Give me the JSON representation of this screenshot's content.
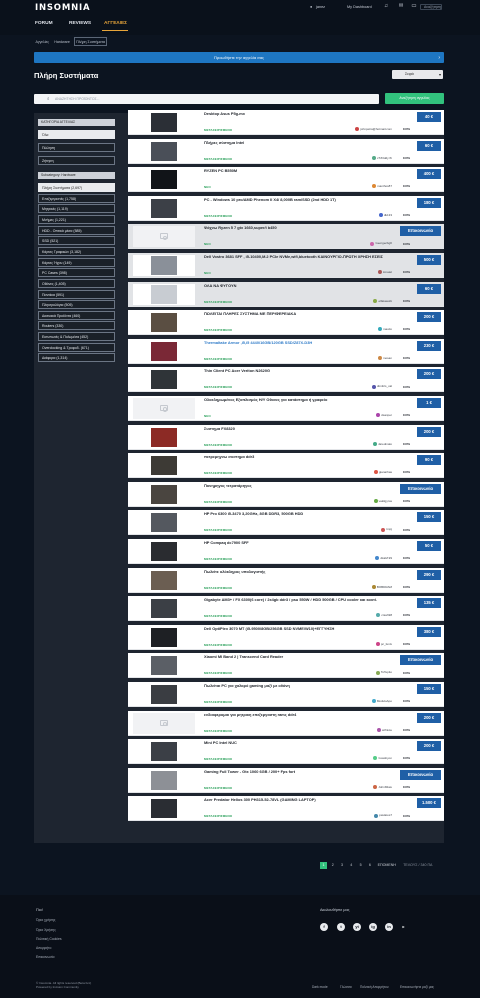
{
  "header": {
    "logo": "INSOMNIA",
    "nav": [
      "FORUM",
      "REVIEWS",
      "ΑΓΓΕΛΙΕΣ"
    ],
    "user": "janez",
    "dashboard": "My Dashboard",
    "search_placeholder": "Αναζήτηση"
  },
  "breadcrumb": [
    "Αγγελίες",
    "Hardware",
    "Πλήρη Συστήματα"
  ],
  "announcement": "Προωθήστε την αγγελία σας",
  "page_title": "Πλήρη Συστήματα",
  "sort_label": "Σειρά",
  "search": {
    "placeholder": "ΑΝΑΖΗΤΗΣΗ ΠΡΟΪΟΝΤΟΣ...",
    "button": "Αναζήτηση αγγελίας"
  },
  "sidebar": {
    "type_header": "ΚΑΤΗΓΟΡΙΑ ΑΓΓΕΛΙΑΣ",
    "types": [
      "Όλα",
      "Πώληση",
      "Ζήτηση"
    ],
    "cat_header": "Subcategory: Hardware",
    "categories": [
      "Πλήρη Συστήματα (2,697)",
      "Επεξεργαστές (1,758)",
      "Μητρικές (1,119)",
      "Μνήμες (1,221)",
      "HDD - Οπτικά μέσα (585)",
      "SSD (521)",
      "Κάρτες Γραφικών (3,182)",
      "Κάρτες Ήχου (149)",
      "PC Cases (398)",
      "Οθόνες (1,405)",
      "Ποντίκια (591)",
      "Πληκτρολόγια (505)",
      "Δικτυακά Προϊόντα (460)",
      "Routers (330)",
      "Εκτυπωτές & Πολυμέσα (452)",
      "Overclocking & Τροφοδ. (671)",
      "Διάφορα (1,314)"
    ]
  },
  "listings": [
    {
      "title": "Desktop Asus P5g-mx",
      "status": "ΜΕΤΑΧΕΙΡΙΣΜΕΝΟ",
      "user": "johnpetra@hotmail.com",
      "pct": "100%",
      "price": "40 €"
    },
    {
      "title": "Πλήρες σύστημα Intel",
      "status": "ΜΕΤΑΧΕΙΡΙΣΜΕΝΟ",
      "user": "xTZ3ddy fb",
      "pct": "100%",
      "price": "60 €"
    },
    {
      "title": "RYZEN PC B550M",
      "status": "ΝΕΟ",
      "user": "manthos87",
      "pct": "100%",
      "price": "400 €"
    },
    {
      "title": "PC - Windows 10 pro/AMD Phenom II X4/ 8,000B ram/SSD (2nd HDD 1T)",
      "status": "ΜΕΤΑΧΕΙΡΙΣΜΕΝΟ",
      "user": "dk133",
      "pct": "100%",
      "price": "180 €"
    },
    {
      "title": "Ψάχνω Ryzen 5 7 gtx 1660,super/i b450",
      "status": "ΝΕΟ",
      "user": "Georgecbgft",
      "pct": "100%",
      "price": "Επικοινωνία"
    },
    {
      "title": "Dell Vostro 3681 SFF , i5-10400,M.2 PCIe NVMe,wifi,bluetooth ΚΑΙΝΟΥΡΓΙΟ-ΠΡΩΤΗ ΧΡΗΣΗ ΕΣΕΙΣ",
      "status": "ΝΕΟ",
      "user": "kmatel",
      "pct": "100%",
      "price": "500 €"
    },
    {
      "title": "ΟΛΑ ΝΑ ΦΥΓΟΥΝ",
      "status": "ΜΕΤΑΧΕΙΡΙΣΜΕΝΟ",
      "user": "elfakasobi",
      "pct": "100%",
      "price": "60 €"
    },
    {
      "title": "ΠΩΛΕΙΤΑΙ ΠΛΗΡΕΣ ΣΥΣΤΗΜΑ ΜΕ ΠΕΡΙΦΕΡΕΙΑΚΑ",
      "status": "ΜΕΤΑΧΕΙΡΙΣΜΕΝΟ",
      "user": "maxdo",
      "pct": "100%",
      "price": "200 €"
    },
    {
      "title": "Thermaltake Armor ,i5,i5 4440/16GB/120GB SSD/Z87X-D3H",
      "status": "ΜΕΤΑΧΕΙΡΙΣΜΕΝΟ",
      "user": "mosan",
      "pct": "100%",
      "price": "230 €"
    },
    {
      "title": "Thin Client PC Acer Veriton N2620G",
      "status": "ΜΕΤΑΧΕΙΡΙΣΜΕΝΟ",
      "user": "dimitris_val",
      "pct": "100%",
      "price": "200 €"
    },
    {
      "title": "Ολοκληρωμένος Εξοπλισμός Η/Υ Οθονες για κατάστημα ή γραφείο",
      "status": "ΝΕΟ",
      "user": "dsanper",
      "pct": "100%",
      "price": "1 €"
    },
    {
      "title": "Συστημα FX8320",
      "status": "ΜΕΤΑΧΕΙΡΙΣΜΕΝΟ",
      "user": "Jaredmalo",
      "pct": "100%",
      "price": "200 €"
    },
    {
      "title": "πετρεμηγνω συστημα ddr3",
      "status": "ΜΕΤΑΧΕΙΡΙΣΜΕΝΟ",
      "user": "gianarhas",
      "pct": "100%",
      "price": "90 €"
    },
    {
      "title": "Πονηρηγος τετρατάρηγος",
      "status": "ΜΕΤΑΧΕΙΡΙΣΜΕΝΟ",
      "user": "vakilgyros",
      "pct": "100%",
      "price": "Επικοινωνία"
    },
    {
      "title": "HP Pro 6300 i5-3470 3,20GHz, 8GB DDR3, 500GB HDD",
      "status": "ΜΕΤΑΧΕΙΡΙΣΜΕΝΟ",
      "user": "tmpj",
      "pct": "100%",
      "price": "150 €"
    },
    {
      "title": "HP Compaq dc7900 SFF",
      "status": "ΜΕΤΑΧΕΙΡΙΣΜΕΝΟ",
      "user": "dkaM.99",
      "pct": "100%",
      "price": "50 €"
    },
    {
      "title": "Πωλείτε ολόκληρος υπολογιστής",
      "status": "ΜΕΤΑΧΕΙΡΙΣΜΕΝΟ",
      "user": "BOBDRAM",
      "pct": "100%",
      "price": "290 €"
    },
    {
      "title": "Gigabyte AM3+ / FX 6300(6 core) / 2x4gb ddr3 / psu 550W / HDD 500GB / CPU cooler και κουτί.",
      "status": "ΜΕΤΑΧΕΙΡΙΣΜΕΝΟ",
      "user": "crash98",
      "pct": "100%",
      "price": "135 €"
    },
    {
      "title": "Dell OptiPlex 3070 MT (i5-9500/8GB/256GB SSD NVME/W10)+ΕΓΓΥΗΣΗ",
      "status": "ΜΕΤΑΧΕΙΡΙΣΜΕΝΟ",
      "user": "pc_fenix",
      "pct": "100%",
      "price": "380 €"
    },
    {
      "title": "Xiaomi MI Band 2 | Transcend Card Reader",
      "status": "ΜΕΤΑΧΕΙΡΙΣΜΕΝΟ",
      "user": "ToTepito",
      "pct": "100%",
      "price": "Επικοινωνία"
    },
    {
      "title": "Πωλείται PC για χαλαρό gaming μαζί με οθόνη",
      "status": "ΜΕΤΑΧΕΙΡΙΣΜΕΝΟ",
      "user": "ModuloApo",
      "pct": "100%",
      "price": "150 €"
    },
    {
      "title": "ενδιαφερομαι για μητρικη επεξεργαστη ramς ddr4",
      "status": "ΜΕΤΑΧΕΙΡΙΣΜΕΝΟ",
      "user": "wtfnixie",
      "pct": "100%",
      "price": "200 €"
    },
    {
      "title": "Mini PC Intel NUC",
      "status": "ΜΕΤΑΧΕΙΡΙΣΜΕΝΟ",
      "user": "Gossbyon",
      "pct": "100%",
      "price": "200 €"
    },
    {
      "title": "Gaming Full Tower - Gtx 1060 6GB / 200+ Fps fort",
      "status": "ΜΕΤΑΧΕΙΡΙΣΜΕΝΟ",
      "user": "JohnMkav",
      "pct": "100%",
      "price": "Επικοινωνία"
    },
    {
      "title": "Acer Predator Helios 300 PH315-52-78VL (GAMING LAPTOP)",
      "status": "ΜΕΤΑΧΕΙΡΙΣΜΕΝΟ",
      "user": "pavlatos7",
      "pct": "100%",
      "price": "1.500 €"
    }
  ],
  "pagination": {
    "pages": [
      "1",
      "2",
      "3",
      "4",
      "5",
      "6"
    ],
    "next": "ΕΠΟΜΕΝΗ",
    "last": "ΤΕΛΟΥΣ / 340 ΠΑ"
  },
  "footer": {
    "col1_title": "Πιο!",
    "links": [
      "Όροι χρήσης",
      "Όροι Χρήσης",
      "Πολιτική Cookies",
      "Απορρήτο",
      "Επικοινωνία"
    ],
    "follow": "Ακολουθήστε μας",
    "social": [
      "f",
      "t",
      "yt",
      "ig",
      "in",
      "rss"
    ],
    "copyright": "© Insomnia. All rights reserved (Beta bcc)",
    "powered": "Powered by Invision Community",
    "bottom_links": [
      "Dark mode",
      "Γλώσσα",
      "Πολιτική Απορρήτου",
      "Επικοινωνήστε μαζί μας"
    ]
  }
}
